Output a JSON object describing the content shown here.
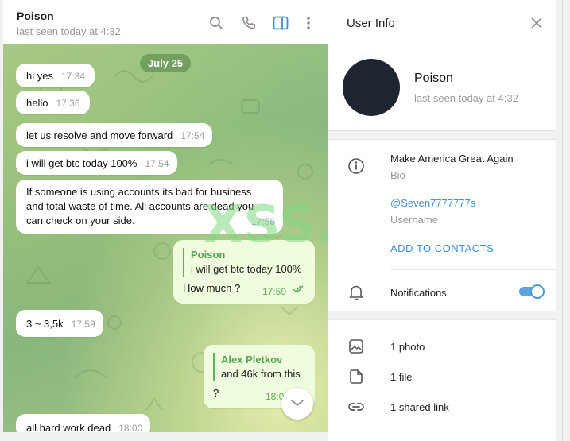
{
  "chat": {
    "title": "Poison",
    "status": "last seen today at 4:32",
    "date_pill": "July 25",
    "messages": [
      {
        "text": "hi yes",
        "time": "17:34"
      },
      {
        "text": "hello",
        "time": "17:36"
      },
      {
        "text": "let us resolve and move forward",
        "time": "17:54"
      },
      {
        "text": "i will get btc today 100%",
        "time": "17:54"
      },
      {
        "lines": [
          "If someone is using accounts its bad for business",
          "and total waste of time. All accounts are dead you",
          "can check on your side."
        ],
        "time": "17:56"
      },
      {
        "reply_name": "Poison",
        "reply_text": "i will get btc today 100%",
        "text": "How much ?",
        "time": "17:59"
      },
      {
        "text": "3 ~ 3,5k",
        "time": "17:59"
      },
      {
        "reply_name": "Alex Pletkov",
        "reply_text": "and 46k from this",
        "text": "?",
        "time": "18:0"
      },
      {
        "text": "all hard work dead",
        "time": "18:00"
      }
    ],
    "watermark": "XSS.is"
  },
  "info": {
    "title": "User Info",
    "name": "Poison",
    "status": "last seen today at 4:32",
    "bio": "Make America Great Again",
    "bio_label": "Bio",
    "username": "@Seven7777777s",
    "username_label": "Username",
    "add_contacts": "ADD TO CONTACTS",
    "notifications": "Notifications",
    "notifications_on": true,
    "photos": "1 photo",
    "files": "1 file",
    "links": "1 shared link"
  },
  "colors": {
    "accent": "#3a8fd6",
    "outgoing_bubble": "#effdde",
    "reply_green": "#55a754"
  },
  "icons": [
    "search-icon",
    "phone-icon",
    "sidebar-toggle-icon",
    "more-vertical-icon",
    "close-icon",
    "info-icon",
    "bell-icon",
    "photo-icon",
    "file-icon",
    "link-icon",
    "chevron-down-icon",
    "double-check-icon"
  ]
}
